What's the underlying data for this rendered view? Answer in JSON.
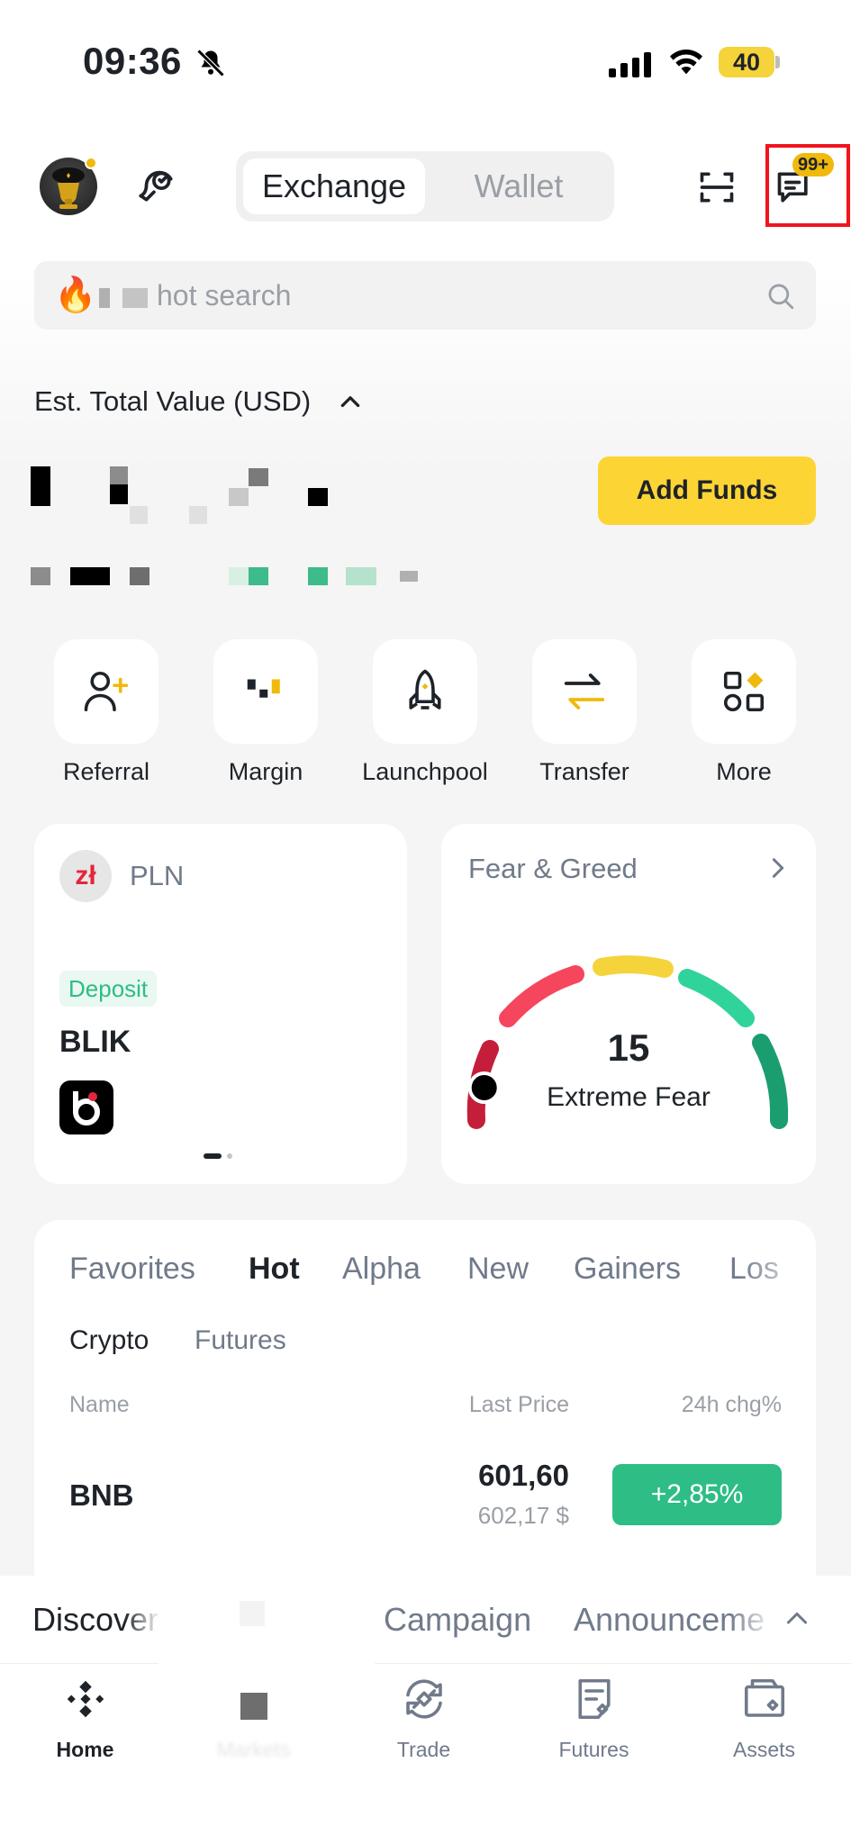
{
  "status_bar": {
    "time": "09:36",
    "battery": "40"
  },
  "header": {
    "segments": [
      "Exchange",
      "Wallet"
    ],
    "active_segment": "Exchange",
    "badge": "99+"
  },
  "search": {
    "placeholder": "hot search"
  },
  "balance": {
    "label": "Est. Total Value (USD)",
    "add_funds_label": "Add Funds"
  },
  "quick_actions": [
    {
      "label": "Referral",
      "icon": "referral-icon"
    },
    {
      "label": "Margin",
      "icon": "margin-icon"
    },
    {
      "label": "Launchpool",
      "icon": "rocket-icon"
    },
    {
      "label": "Transfer",
      "icon": "transfer-icon"
    },
    {
      "label": "More",
      "icon": "more-apps-icon"
    }
  ],
  "deposit_card": {
    "currency": "PLN",
    "currency_logo": "zł",
    "tag": "Deposit",
    "method": "BLIK"
  },
  "fear_greed": {
    "title": "Fear & Greed",
    "value": "15",
    "label": "Extreme Fear",
    "level": 0.15
  },
  "market": {
    "tabs": [
      "Favorites",
      "Hot",
      "Alpha",
      "New",
      "Gainers",
      "Los"
    ],
    "active_tab": "Hot",
    "subtabs": [
      "Crypto",
      "Futures"
    ],
    "active_subtab": "Crypto",
    "columns": {
      "name": "Name",
      "last_price": "Last Price",
      "change": "24h chg%"
    },
    "rows": [
      {
        "name": "BNB",
        "price": "601,60",
        "price_usd": "602,17 $",
        "change": "+2,85%"
      }
    ]
  },
  "discover": {
    "tabs": [
      "Discover",
      "Campaign",
      "Announceme"
    ]
  },
  "bottom_nav": {
    "items": [
      {
        "label": "Home",
        "icon": "home-icon",
        "active": true
      },
      {
        "label": "Markets",
        "icon": "markets-icon",
        "active": false
      },
      {
        "label": "Trade",
        "icon": "trade-icon",
        "active": false
      },
      {
        "label": "Futures",
        "icon": "futures-icon",
        "active": false
      },
      {
        "label": "Assets",
        "icon": "assets-icon",
        "active": false
      }
    ]
  },
  "colors": {
    "brand_yellow": "#FCD535",
    "accent_yellow": "#F0B90B",
    "up_green": "#2EBD85",
    "highlight_red": "#F0141E"
  }
}
